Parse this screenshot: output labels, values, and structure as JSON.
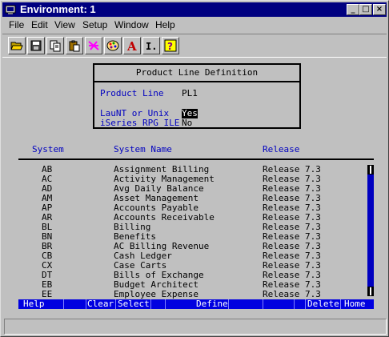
{
  "window": {
    "title": "Environment: 1",
    "minimize": "_",
    "maximize": "□",
    "close": "×"
  },
  "menu": [
    "File",
    "Edit",
    "View",
    "Setup",
    "Window",
    "Help"
  ],
  "toolbar": {
    "icons": [
      "open-folder-icon",
      "save-icon",
      "copy-icon",
      "paste-icon",
      "highlighter-icon",
      "palette-icon",
      "font-icon",
      "cursor-insert-icon",
      "help-question-icon"
    ],
    "font_glyph": "A",
    "cursor_glyph": "I.",
    "help_glyph": "?"
  },
  "panel": {
    "title": "Product Line Definition",
    "product_line_label": "Product Line",
    "product_line_value": "PL1",
    "launt_label": "LauNT or Unix",
    "launt_value": "Yes",
    "iseries_label": "iSeries RPG ILE",
    "iseries_value": "No"
  },
  "table": {
    "headers": {
      "system": "System",
      "name": "System Name",
      "release": "Release"
    },
    "rows": [
      {
        "system": "AB",
        "name": "Assignment Billing",
        "release": "Release 7.3"
      },
      {
        "system": "AC",
        "name": "Activity Management",
        "release": "Release 7.3"
      },
      {
        "system": "AD",
        "name": "Avg Daily Balance",
        "release": "Release 7.3"
      },
      {
        "system": "AM",
        "name": "Asset Management",
        "release": "Release 7.3"
      },
      {
        "system": "AP",
        "name": "Accounts Payable",
        "release": "Release 7.3"
      },
      {
        "system": "AR",
        "name": "Accounts Receivable",
        "release": "Release 7.3"
      },
      {
        "system": "BL",
        "name": "Billing",
        "release": "Release 7.3"
      },
      {
        "system": "BN",
        "name": "Benefits",
        "release": "Release 7.3"
      },
      {
        "system": "BR",
        "name": "AC Billing Revenue",
        "release": "Release 7.3"
      },
      {
        "system": "CB",
        "name": "Cash Ledger",
        "release": "Release 7.3"
      },
      {
        "system": "CX",
        "name": "Case Carts",
        "release": "Release 7.3"
      },
      {
        "system": "DT",
        "name": "Bills of Exchange",
        "release": "Release 7.3"
      },
      {
        "system": "EB",
        "name": "Budget Architect",
        "release": "Release 7.3"
      },
      {
        "system": "EE",
        "name": "Employee Expense",
        "release": "Release 7.3"
      }
    ]
  },
  "function_keys": {
    "help": "Help",
    "clear": "Clear",
    "select": "Select",
    "define": "Define",
    "delete": "Delete",
    "home": "Home"
  },
  "colors": {
    "titlebar": "#000080",
    "terminal_text_blue": "#0000c0",
    "fkey_bar": "#0000e0"
  }
}
